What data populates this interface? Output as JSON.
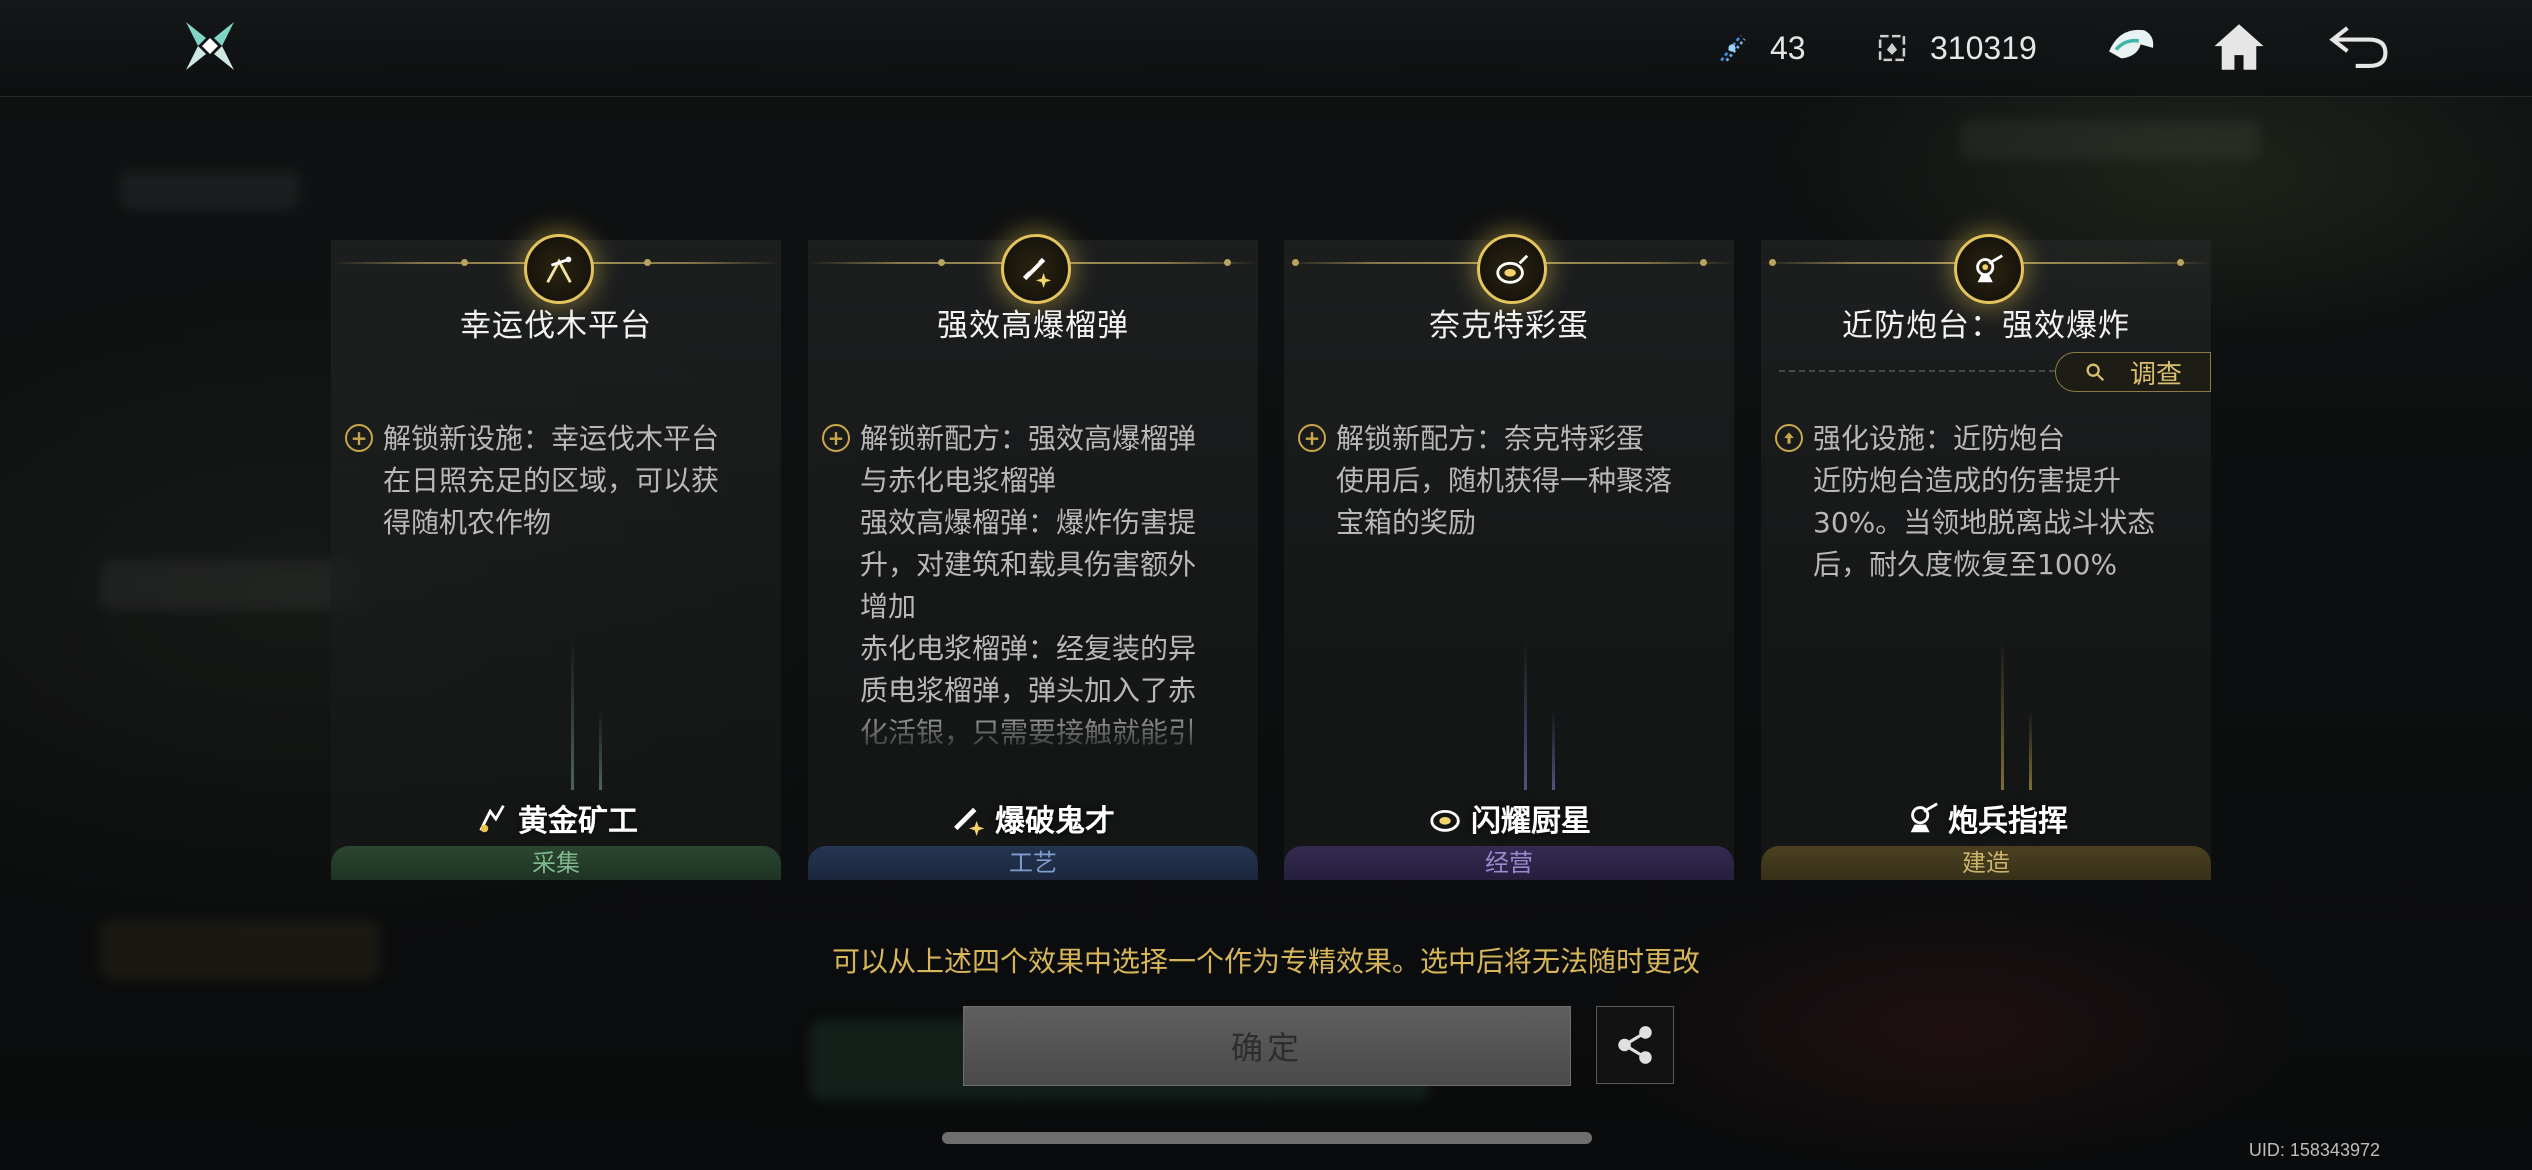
{
  "header": {
    "currency_1": {
      "icon": "energy-crystal-icon",
      "value": "43"
    },
    "currency_2": {
      "icon": "token-icon",
      "value": "310319"
    },
    "buttons": [
      "mech-helmet-icon",
      "home-icon",
      "back-icon"
    ]
  },
  "cards": [
    {
      "title": "幸运伐木平台",
      "effect_icon": "plus-circle-icon",
      "description": "解锁新设施：幸运伐木平台\n在日照充足的区域，可以获\n得随机农作物",
      "role": "黄金矿工",
      "category": "采集",
      "category_color": "#7fb88c"
    },
    {
      "title": "强效高爆榴弹",
      "effect_icon": "plus-circle-icon",
      "description": "解锁新配方：强效高爆榴弹\n与赤化电浆榴弹\n强效高爆榴弹：爆炸伤害提\n升，对建筑和载具伤害额外\n增加\n赤化电浆榴弹：经复装的异\n质电浆榴弹，弹头加入了赤\n化活银，只需要接触就能引\n发小规模的蚀切反应，会力",
      "role": "爆破鬼才",
      "category": "工艺",
      "category_color": "#7f9cd0"
    },
    {
      "title": "奈克特彩蛋",
      "effect_icon": "plus-circle-icon",
      "description": "解锁新配方：奈克特彩蛋\n使用后，随机获得一种聚落\n宝箱的奖励",
      "role": "闪耀厨星",
      "category": "经营",
      "category_color": "#9b88cf"
    },
    {
      "title": "近防炮台：强效爆炸",
      "effect_icon": "upgrade-icon",
      "description": "强化设施：近防炮台\n近防炮台造成的伤害提升\n30%。当领地脱离战斗状态\n后，耐久度恢复至100%",
      "role": "炮兵指挥",
      "category": "建造",
      "category_color": "#cdb46a",
      "investigate_label": "调查"
    }
  ],
  "hint": "可以从上述四个效果中选择一个作为专精效果。选中后将无法随时更改",
  "confirm_label": "确定",
  "uid": "UID: 158343972"
}
